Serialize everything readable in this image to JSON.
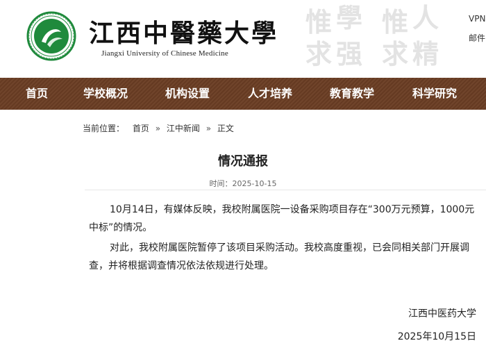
{
  "header": {
    "school_name_cn": "江西中醫藥大學",
    "school_name_en": "Jiangxi University of Chinese Medicine",
    "motto_chars": [
      "惟",
      "學",
      "惟",
      "人",
      "求",
      "强",
      "求",
      "精"
    ],
    "top_links": {
      "vpn": "VPN",
      "mail": "邮件"
    },
    "colors": {
      "seal_green": "#1f8a3c",
      "nav_brown": "#6b3e24"
    }
  },
  "nav": {
    "items": [
      "首页",
      "学校概况",
      "机构设置",
      "人才培养",
      "教育教学",
      "科学研究"
    ]
  },
  "breadcrumb": {
    "label": "当前位置：",
    "items": [
      "首页",
      "江中新闻",
      "正文"
    ],
    "separator": "»"
  },
  "article": {
    "title": "情况通报",
    "meta": "时间：2025-10-15",
    "paragraphs": [
      "10月14日，有媒体反映，我校附属医院一设备采购项目存在“300万元预算，1000元中标”的情况。",
      "对此，我校附属医院暂停了该项目采购活动。我校高度重视，已会同相关部门开展调查，并将根据调查情况依法依规进行处理。"
    ],
    "signature_org": "江西中医药大学",
    "signature_date": "2025年10月15日"
  }
}
